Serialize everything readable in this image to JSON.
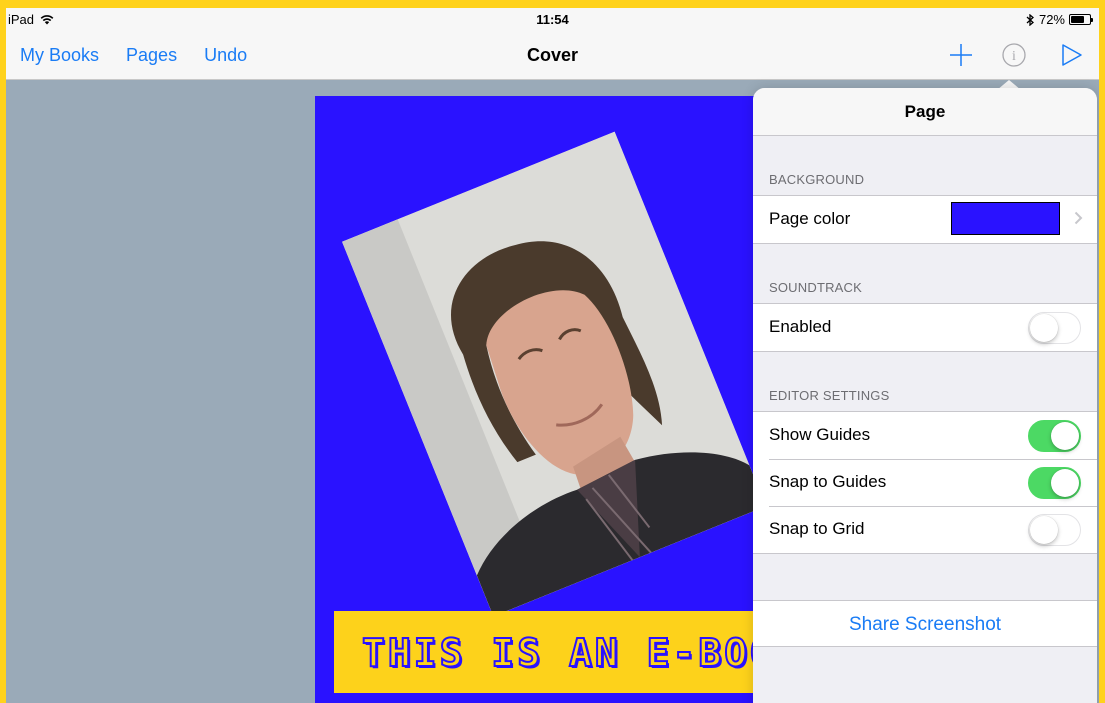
{
  "status_bar": {
    "device": "iPad",
    "time": "11:54",
    "battery": "72%",
    "battery_level": 0.72
  },
  "nav": {
    "left_buttons": [
      "My Books",
      "Pages",
      "Undo"
    ],
    "title": "Cover",
    "right_icons": [
      "plus-icon",
      "info-icon",
      "play-icon"
    ]
  },
  "page": {
    "background_color": "#2a12ff",
    "banner_text": "THIS IS AN E-BOOK",
    "banner_color": "#fdd21b"
  },
  "popover": {
    "title": "Page",
    "sections": {
      "background": {
        "header": "BACKGROUND",
        "page_color_label": "Page color",
        "page_color": "#2a12ff"
      },
      "soundtrack": {
        "header": "SOUNDTRACK",
        "enabled_label": "Enabled",
        "enabled": false
      },
      "editor": {
        "header": "EDITOR SETTINGS",
        "show_guides_label": "Show Guides",
        "show_guides": true,
        "snap_guides_label": "Snap to Guides",
        "snap_guides": true,
        "snap_grid_label": "Snap to Grid",
        "snap_grid": false
      }
    },
    "share_label": "Share Screenshot"
  },
  "colors": {
    "accent": "#1a7cf5",
    "toggle_on": "#4cd964",
    "frame": "#ffd21c",
    "canvas_bg": "#9aaab8"
  }
}
